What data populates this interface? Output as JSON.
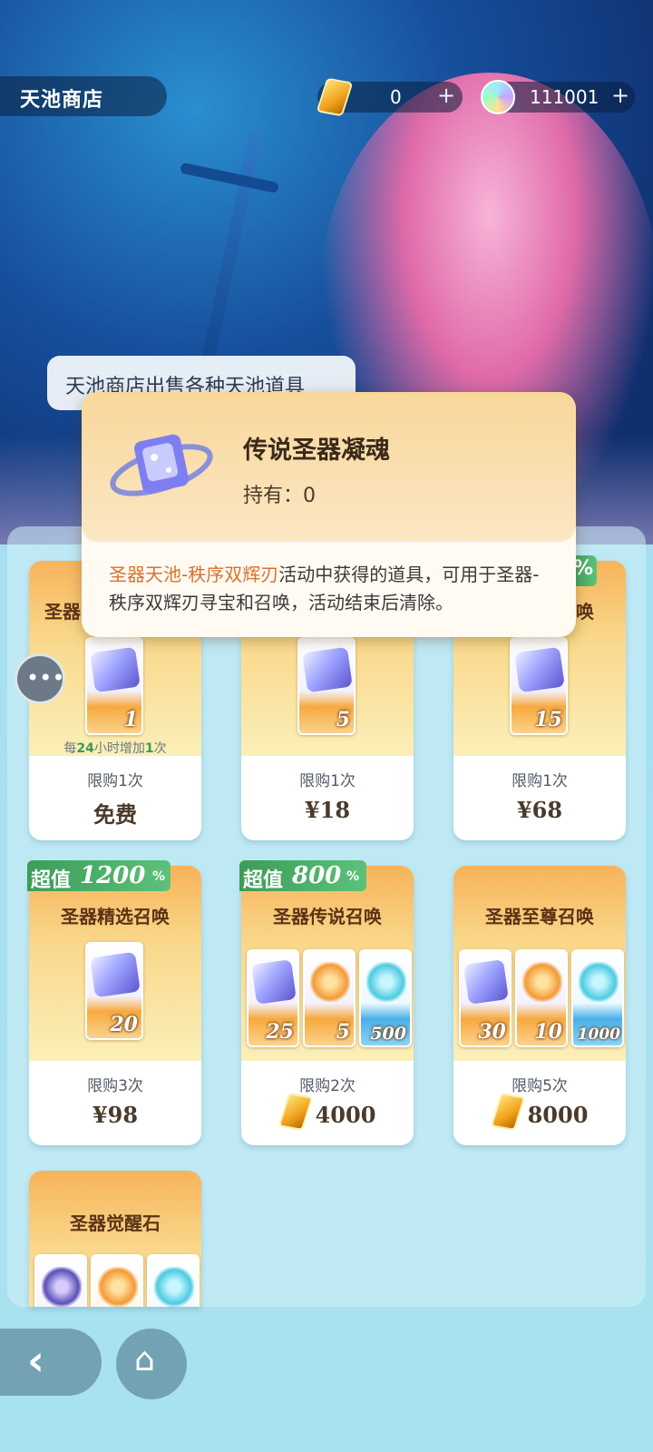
{
  "header": {
    "title": "天池商店"
  },
  "currencies": [
    {
      "icon": "gold-crystal-icon",
      "value": "0",
      "plus": "+"
    },
    {
      "icon": "rainbow-gem-icon",
      "value": "111001",
      "plus": "+"
    }
  ],
  "speech": "天池商店出售各种天池道具",
  "tooltip": {
    "title": "传说圣器凝魂",
    "owned": "持有：0",
    "desc_highlight": "圣器天池-秩序双辉刃",
    "desc_rest": "活动中获得的道具，可用于圣器-秩序双辉刃寻宝和召唤，活动结束后清除。"
  },
  "cards": [
    {
      "name": "圣器",
      "badge_tail": "%",
      "items": [
        {
          "count": "1"
        }
      ],
      "refresh_pre": "每",
      "refresh_num": "24",
      "refresh_mid": "小时增加",
      "refresh_num2": "1",
      "refresh_post": "次",
      "limit": "限购1次",
      "price": "免费"
    },
    {
      "items": [
        {
          "count": "5"
        }
      ],
      "limit": "限购1次",
      "price": "¥18"
    },
    {
      "name": "唤",
      "items": [
        {
          "count": "15"
        }
      ],
      "limit": "限购1次",
      "price": "¥68"
    },
    {
      "name": "圣器精选召唤",
      "badge_text": "超值",
      "badge_num": "1200",
      "badge_pct": "%",
      "items": [
        {
          "count": "20"
        }
      ],
      "limit": "限购3次",
      "price": "¥98"
    },
    {
      "name": "圣器传说召唤",
      "badge_text": "超值",
      "badge_num": "800",
      "badge_pct": "%",
      "items": [
        {
          "count": "25"
        },
        {
          "count": "5"
        },
        {
          "count": "500"
        }
      ],
      "limit": "限购2次",
      "price": "4000"
    },
    {
      "name": "圣器至尊召唤",
      "items": [
        {
          "count": "30"
        },
        {
          "count": "10"
        },
        {
          "count": "1000"
        }
      ],
      "limit": "限购5次",
      "price": "8000"
    },
    {
      "name": "圣器觉醒石"
    }
  ],
  "nav": {
    "back": "‹",
    "home": "⌂",
    "chat": "•••"
  },
  "colors": {
    "accent_orange": "#d9722a",
    "badge_green": "#3c9c58",
    "card_top": "#f7b35a"
  }
}
